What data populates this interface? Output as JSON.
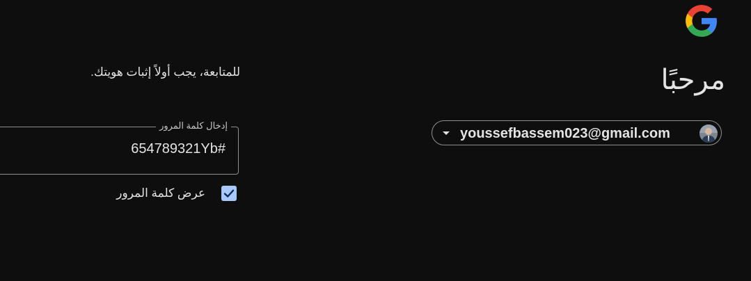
{
  "header": {
    "logo_icon": "google-g-logo-icon",
    "title": "مرحبًا",
    "subtitle": "للمتابعة، يجب أولاً إثبات هويتك."
  },
  "account": {
    "email": "youssefbassem023@gmail.com",
    "avatar_icon": "user-avatar",
    "dropdown_icon": "chevron-down-icon"
  },
  "password": {
    "label": "إدخال كلمة المرور",
    "value": "654789321Yb#"
  },
  "show_password": {
    "label": "عرض كلمة المرور",
    "checked": true
  },
  "colors": {
    "background": "#0e0e0f",
    "text": "#e3e3e3",
    "border": "#8e918f",
    "checkbox": "#a8c7fa"
  }
}
